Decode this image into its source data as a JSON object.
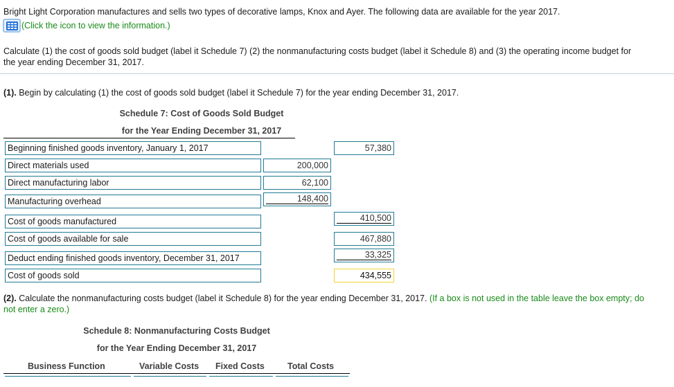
{
  "intro": {
    "text": "Bright Light Corporation manufactures and sells two types of decorative lamps, Knox and Ayer. The following data are available for the year 2017.",
    "info_icon": "table-grid-icon",
    "info_link": "(Click the icon to view the information.)"
  },
  "task": {
    "line1": "Calculate (1) the cost of goods sold budget (label it Schedule 7) (2) the nonmanufacturing costs budget (label it Schedule 8) and  (3) the operating income budget for",
    "line2": "the year ending December 31, 2017."
  },
  "part1": {
    "prefix": "(1).",
    "instruction": " Begin by calculating (1) the cost of goods sold budget (label it Schedule 7) for the year ending December 31, 2017.",
    "schedule_title": "Schedule 7: Cost of Goods Sold Budget",
    "schedule_subtitle": "for the Year Ending December 31, 2017",
    "rows": [
      {
        "label": "Beginning finished goods inventory, January 1, 2017",
        "mid": "",
        "right": "57,380"
      },
      {
        "label": "Direct materials used",
        "mid": "200,000",
        "right": ""
      },
      {
        "label": "Direct manufacturing labor",
        "mid": "62,100",
        "right": ""
      },
      {
        "label": "Manufacturing overhead",
        "mid": "148,400",
        "right": ""
      },
      {
        "label": "Cost of goods manufactured",
        "mid": "",
        "right": "410,500"
      },
      {
        "label": "Cost of goods available for sale",
        "mid": "",
        "right": "467,880"
      },
      {
        "label": "Deduct ending finished goods inventory, December 31, 2017",
        "mid": "",
        "right": "33,325"
      },
      {
        "label": "Cost of goods sold",
        "mid": "",
        "right": "434,555"
      }
    ]
  },
  "part2": {
    "prefix": "(2).",
    "instruction": " Calculate the nonmanufacturing costs budget (label it Schedule 8) for the year ending December 31, 2017.",
    "note_line1": " (If a box is not used in the table leave the box empty; do",
    "note_line2": "not enter a zero.)",
    "schedule_title": "Schedule 8: Nonmanufacturing Costs Budget",
    "schedule_subtitle": "for the Year Ending December 31, 2017",
    "columns": [
      "Business Function",
      "Variable Costs",
      "Fixed Costs",
      "Total Costs"
    ]
  }
}
